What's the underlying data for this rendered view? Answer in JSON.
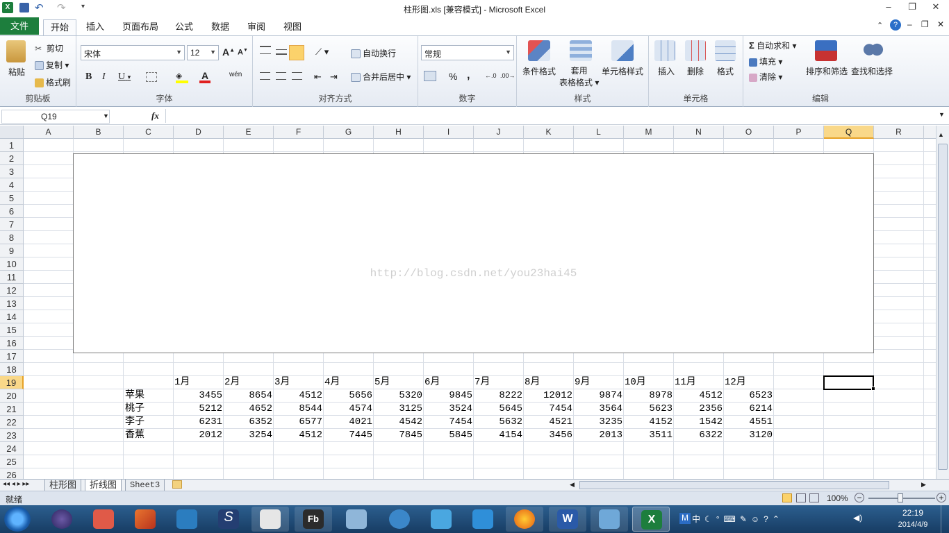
{
  "window": {
    "title": "柱形图.xls  [兼容模式] - Microsoft Excel"
  },
  "qat": {
    "save": "save-icon",
    "undo": "undo-icon",
    "redo": "redo-icon"
  },
  "tabs": [
    "文件",
    "开始",
    "插入",
    "页面布局",
    "公式",
    "数据",
    "审阅",
    "视图"
  ],
  "ribbon": {
    "clipboard": {
      "title": "剪贴板",
      "paste": "粘贴",
      "cut": "剪切",
      "copy": "复制",
      "format_painter": "格式刷"
    },
    "font": {
      "title": "字体",
      "name": "宋体",
      "size": "12",
      "bold": "B",
      "italic": "I",
      "underline": "U",
      "wen": "wén"
    },
    "alignment": {
      "title": "对齐方式",
      "wrap": "自动换行",
      "merge": "合并后居中"
    },
    "number": {
      "title": "数字",
      "format": "常规",
      "percent": "%",
      "comma": ","
    },
    "styles": {
      "title": "样式",
      "conditional": "条件格式",
      "table_1": "套用",
      "table_2": "表格格式",
      "cell_styles": "单元格样式"
    },
    "cells": {
      "title": "单元格",
      "insert": "插入",
      "delete": "删除",
      "format": "格式"
    },
    "editing": {
      "title": "编辑",
      "autosum": "自动求和",
      "fill": "填充",
      "clear": "清除",
      "sort": "排序和筛选",
      "find": "查找和选择"
    }
  },
  "formula_bar": {
    "cell_ref": "Q19",
    "fx": "fx",
    "value": ""
  },
  "columns": [
    "A",
    "B",
    "C",
    "D",
    "E",
    "F",
    "G",
    "H",
    "I",
    "J",
    "K",
    "L",
    "M",
    "N",
    "O",
    "P",
    "Q",
    "R"
  ],
  "rows": [
    "1",
    "2",
    "3",
    "4",
    "5",
    "6",
    "7",
    "8",
    "9",
    "10",
    "11",
    "12",
    "13",
    "14",
    "15",
    "16",
    "17",
    "18",
    "19",
    "20",
    "21",
    "22",
    "23",
    "24",
    "25",
    "26"
  ],
  "chart": {
    "watermark": "http://blog.csdn.net/you23hai45"
  },
  "table": {
    "months": [
      "1月",
      "2月",
      "3月",
      "4月",
      "5月",
      "6月",
      "7月",
      "8月",
      "9月",
      "10月",
      "11月",
      "12月"
    ],
    "rows": [
      {
        "name": "苹果",
        "values": [
          "3455",
          "8654",
          "4512",
          "5656",
          "5320",
          "9845",
          "8222",
          "12012",
          "9874",
          "8978",
          "4512",
          "6523"
        ]
      },
      {
        "name": "桃子",
        "values": [
          "5212",
          "4652",
          "8544",
          "4574",
          "3125",
          "3524",
          "5645",
          "7454",
          "3564",
          "5623",
          "2356",
          "6214"
        ]
      },
      {
        "name": "李子",
        "values": [
          "6231",
          "6352",
          "6577",
          "4021",
          "4542",
          "7454",
          "5632",
          "4521",
          "3235",
          "4152",
          "1542",
          "4551"
        ]
      },
      {
        "name": "香蕉",
        "values": [
          "2012",
          "3254",
          "4512",
          "7445",
          "7845",
          "5845",
          "4154",
          "3456",
          "2013",
          "3511",
          "6322",
          "3120"
        ]
      }
    ]
  },
  "sheets": [
    "柱形图",
    "折线图",
    "Sheet3"
  ],
  "status": {
    "ready": "就绪",
    "zoom": "100%"
  },
  "clock": {
    "time": "22:19",
    "date": "2014/4/9"
  },
  "colors": {
    "accent": "#1d7e3d",
    "selected_header": "#f9d889"
  }
}
